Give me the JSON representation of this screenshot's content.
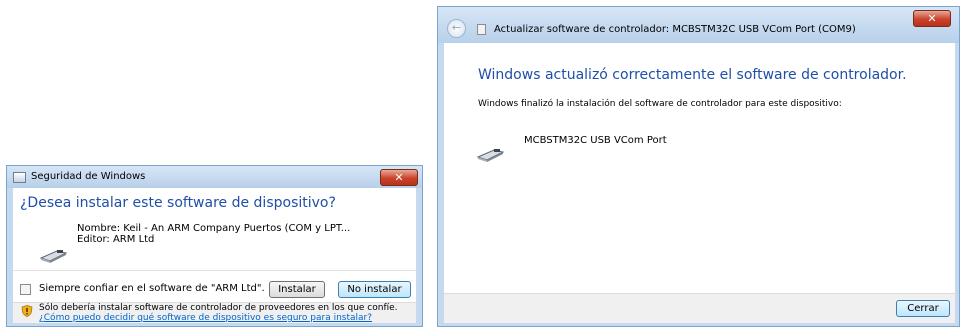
{
  "left_dialog": {
    "title": "Seguridad de Windows",
    "close_glyph": "✕",
    "heading": "¿Desea instalar este software de dispositivo?",
    "name_line": "Nombre: Keil - An ARM Company Puertos (COM y LPT...",
    "editor_line": "Editor: ARM Ltd",
    "trust_checkbox_label": "Siempre confiar en el software de \"ARM Ltd\".",
    "install_button": "Instalar",
    "dont_install_button": "No instalar",
    "warning_text": "Sólo debería instalar software de controlador de proveedores en los que confíe.",
    "help_link": "¿Cómo puedo decidir qué software de dispositivo es seguro para instalar?",
    "icons": [
      "window-icon",
      "close-icon",
      "usb-device-icon",
      "shield-icon",
      "checkbox"
    ]
  },
  "right_dialog": {
    "title": "Actualizar software de controlador: MCBSTM32C USB VCom Port (COM9)",
    "back_glyph": "←",
    "close_glyph": "✕",
    "heading": "Windows actualizó correctamente el software de controlador.",
    "description": "Windows finalizó la instalación del software de controlador para este dispositivo:",
    "device_name": "MCBSTM32C USB VCom Port",
    "close_button": "Cerrar",
    "icons": [
      "back-arrow-icon",
      "document-icon",
      "close-icon",
      "usb-device-icon"
    ]
  },
  "colors": {
    "heading_blue": "#1f4fa8",
    "link_blue": "#0066cc",
    "close_red": "#c9432a",
    "frame_blue": "#c5d9ef"
  }
}
